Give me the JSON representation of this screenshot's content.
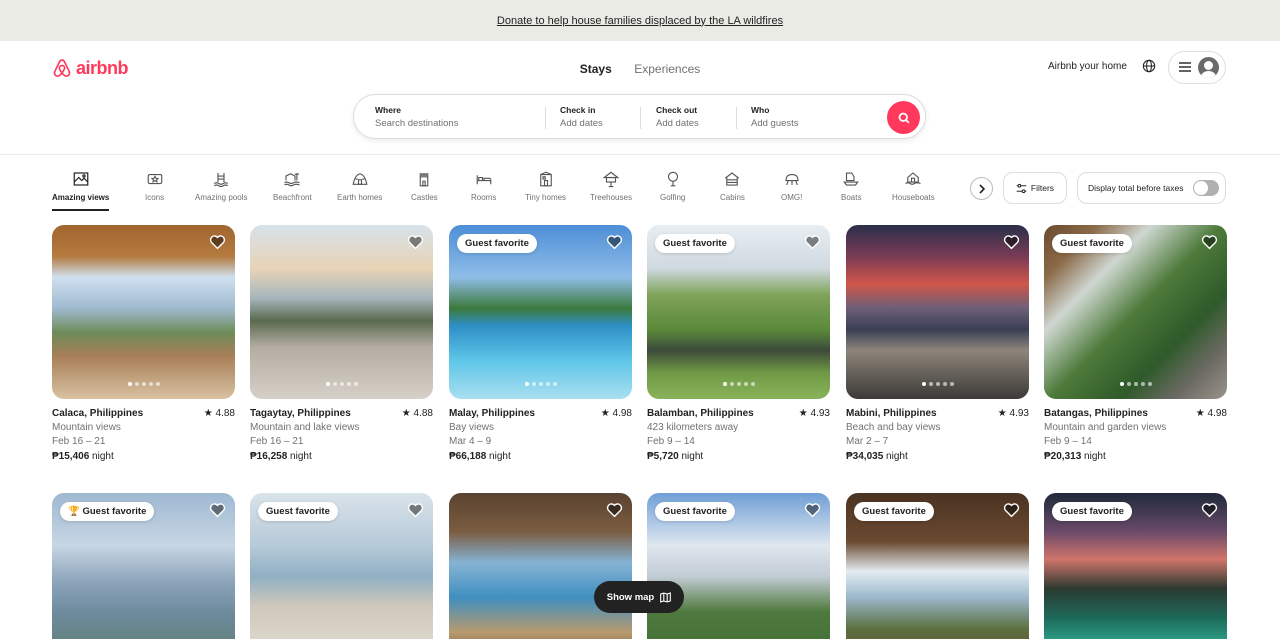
{
  "banner": {
    "text": "Donate to help house families displaced by the LA wildfires"
  },
  "header": {
    "logo_text": "airbnb",
    "tabs": [
      {
        "label": "Stays"
      },
      {
        "label": "Experiences"
      }
    ],
    "host_link": "Airbnb your home",
    "icons": {
      "globe": "globe-icon",
      "menu": "hamburger-icon",
      "avatar": "avatar-icon"
    }
  },
  "search": {
    "fields": [
      {
        "label": "Where",
        "placeholder": "Search destinations"
      },
      {
        "label": "Check in",
        "placeholder": "Add dates"
      },
      {
        "label": "Check out",
        "placeholder": "Add dates"
      },
      {
        "label": "Who",
        "placeholder": "Add guests"
      }
    ],
    "button_icon": "search-icon",
    "accent": "#ff385c"
  },
  "categories": [
    {
      "label": "Amazing views",
      "active": true
    },
    {
      "label": "Icons"
    },
    {
      "label": "Amazing pools"
    },
    {
      "label": "Beachfront"
    },
    {
      "label": "Earth homes"
    },
    {
      "label": "Castles"
    },
    {
      "label": "Rooms"
    },
    {
      "label": "Tiny homes"
    },
    {
      "label": "Treehouses"
    },
    {
      "label": "Golfing"
    },
    {
      "label": "Cabins"
    },
    {
      "label": "OMG!"
    },
    {
      "label": "Boats"
    },
    {
      "label": "Houseboats"
    }
  ],
  "filters": {
    "label": "Filters"
  },
  "tax_toggle": {
    "label": "Display total before taxes",
    "on": false
  },
  "listings": [
    {
      "location": "Calaca, Philippines",
      "rating": "★ 4.88",
      "desc": "Mountain views",
      "dates": "Feb 16 – 21",
      "price": "₱15,406",
      "per": " night",
      "badge": "",
      "active_dot": 0
    },
    {
      "location": "Tagaytay, Philippines",
      "rating": "★ 4.88",
      "desc": "Mountain and lake views",
      "dates": "Feb 16 – 21",
      "price": "₱16,258",
      "per": " night",
      "badge": "",
      "active_dot": 0
    },
    {
      "location": "Malay, Philippines",
      "rating": "★ 4.98",
      "desc": "Bay views",
      "dates": "Mar 4 – 9",
      "price": "₱66,188",
      "per": " night",
      "badge": "Guest favorite",
      "active_dot": 0
    },
    {
      "location": "Balamban, Philippines",
      "rating": "★ 4.93",
      "desc": "423 kilometers away",
      "dates": "Feb 9 – 14",
      "price": "₱5,720",
      "per": " night",
      "badge": "Guest favorite",
      "active_dot": 0
    },
    {
      "location": "Mabini, Philippines",
      "rating": "★ 4.93",
      "desc": "Beach and bay views",
      "dates": "Mar 2 – 7",
      "price": "₱34,035",
      "per": " night",
      "badge": "",
      "active_dot": 0
    },
    {
      "location": "Batangas, Philippines",
      "rating": "★ 4.98",
      "desc": "Mountain and garden views",
      "dates": "Feb 9 – 14",
      "price": "₱20,313",
      "per": " night",
      "badge": "Guest favorite",
      "active_dot": 0
    },
    {
      "badge": "Guest favorite",
      "trophy": true
    },
    {
      "badge": "Guest favorite"
    },
    {
      "badge": ""
    },
    {
      "badge": "Guest favorite"
    },
    {
      "badge": "Guest favorite"
    },
    {
      "badge": "Guest favorite"
    }
  ],
  "show_map": {
    "label": "Show map",
    "icon": "map-icon"
  }
}
